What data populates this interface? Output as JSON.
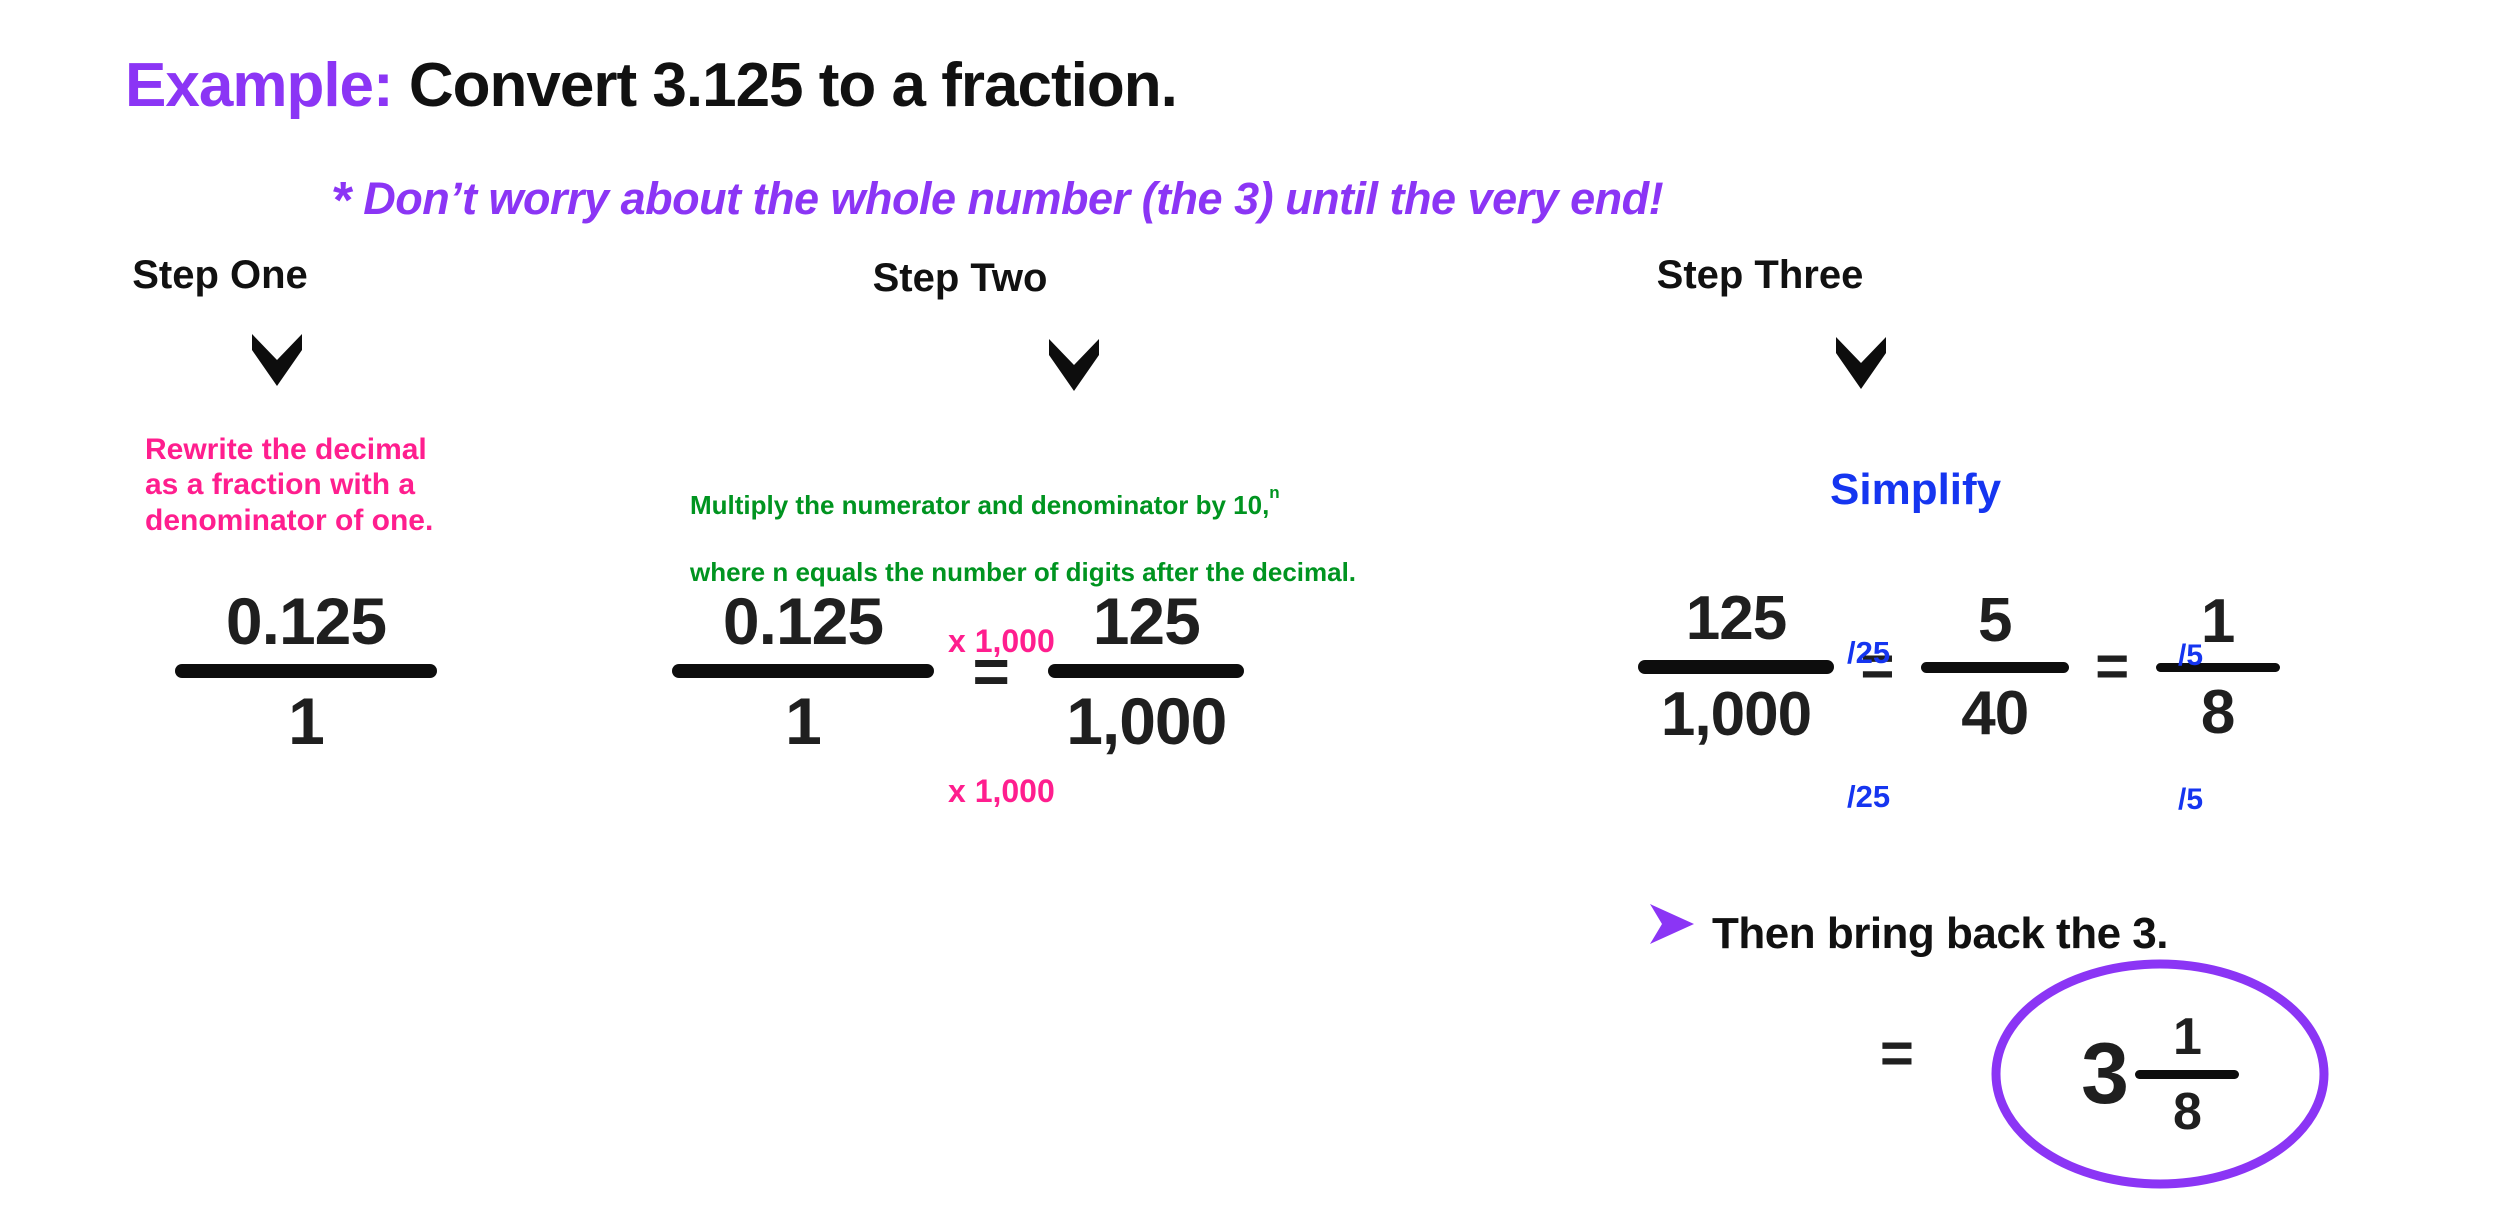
{
  "title": {
    "label": "Example:",
    "statement": "Convert 3.125 to a fraction."
  },
  "note": {
    "bullet": "*",
    "text": "Don’t worry about the whole number (the 3) until the very end!"
  },
  "steps": [
    {
      "header": "Step One",
      "arrow": "chevron-down-icon",
      "description": "Rewrite the decimal\nas a fraction with a\ndenominator of one.",
      "description_color": "#FF1E8E"
    },
    {
      "header": "Step Two",
      "arrow": "chevron-down-icon",
      "description_line1": "Multiply the numerator and denominator by 10,",
      "description_exponent": "n",
      "description_line2": "where n equals the number of digits after the decimal.",
      "description_color": "#009420"
    },
    {
      "header": "Step Three",
      "arrow": "chevron-down-icon",
      "description": "Simplify",
      "description_color": "#1535F0"
    }
  ],
  "math": {
    "step_one": {
      "numerator": "0.125",
      "denominator": "1"
    },
    "step_two": {
      "left": {
        "numerator": "0.125",
        "denominator": "1"
      },
      "equals": "=",
      "right": {
        "numerator": "125",
        "denominator": "1,000"
      },
      "multiplier_top": "x 1,000",
      "multiplier_bottom": "x 1,000",
      "multiplier_color": "#FF1E8E"
    },
    "step_three": {
      "first": {
        "numerator": "125",
        "denominator": "1,000"
      },
      "equals_1": "=",
      "second": {
        "numerator": "5",
        "denominator": "40"
      },
      "equals_2": "=",
      "third": {
        "numerator": "1",
        "denominator": "8"
      },
      "divisor_first_top": "/25",
      "divisor_first_bottom": "/25",
      "divisor_second_top": "/5",
      "divisor_second_bottom": "/5",
      "divisor_color": "#1535F0"
    }
  },
  "bring_back": {
    "bullet_icon": "triangle-right-icon",
    "bullet_color": "#8B35F5",
    "text": "Then bring back the 3."
  },
  "final_answer": {
    "equals": "=",
    "whole_number": "3",
    "numerator": "1",
    "denominator": "8",
    "highlight_color": "#8B35F5"
  }
}
